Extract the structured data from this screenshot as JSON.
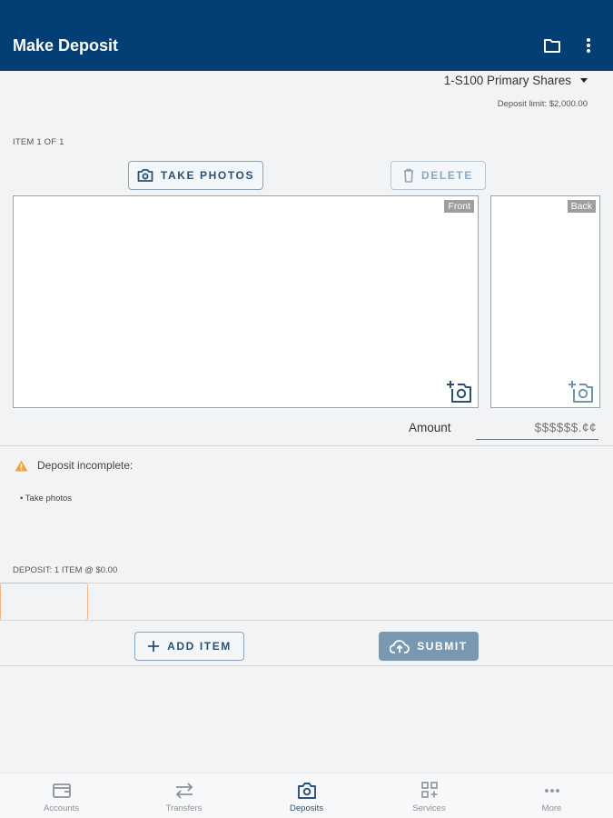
{
  "header": {
    "title": "Make Deposit",
    "folder_icon": "folder-icon",
    "menu_icon": "more-vertical-icon"
  },
  "account": {
    "selected": "1-S100 Primary Shares",
    "deposit_limit": "Deposit limit: $2,000.00"
  },
  "item": {
    "counter": "ITEM 1 OF 1",
    "take_photos_label": "TAKE PHOTOS",
    "delete_label": "DELETE",
    "front_tag": "Front",
    "back_tag": "Back"
  },
  "amount": {
    "label": "Amount",
    "placeholder": "$$$$$$.¢¢"
  },
  "status": {
    "message": "Deposit incomplete:",
    "todo": "• Take photos"
  },
  "summary": {
    "text": "DEPOSIT: 1 ITEM @ $0.00"
  },
  "actions": {
    "add_item_label": "ADD ITEM",
    "submit_label": "SUBMIT"
  },
  "colors": {
    "appbar": "#033f74",
    "primary_text": "#2a5077",
    "submit": "#7999b2",
    "warning": "#f0a53a",
    "thumb_border": "#f3b48a"
  },
  "nav": {
    "items": [
      {
        "label": "Accounts",
        "icon": "wallet-icon"
      },
      {
        "label": "Transfers",
        "icon": "transfer-arrows-icon"
      },
      {
        "label": "Deposits",
        "icon": "camera-icon",
        "active": true
      },
      {
        "label": "Services",
        "icon": "services-grid-icon"
      },
      {
        "label": "More",
        "icon": "more-horizontal-icon"
      }
    ]
  }
}
